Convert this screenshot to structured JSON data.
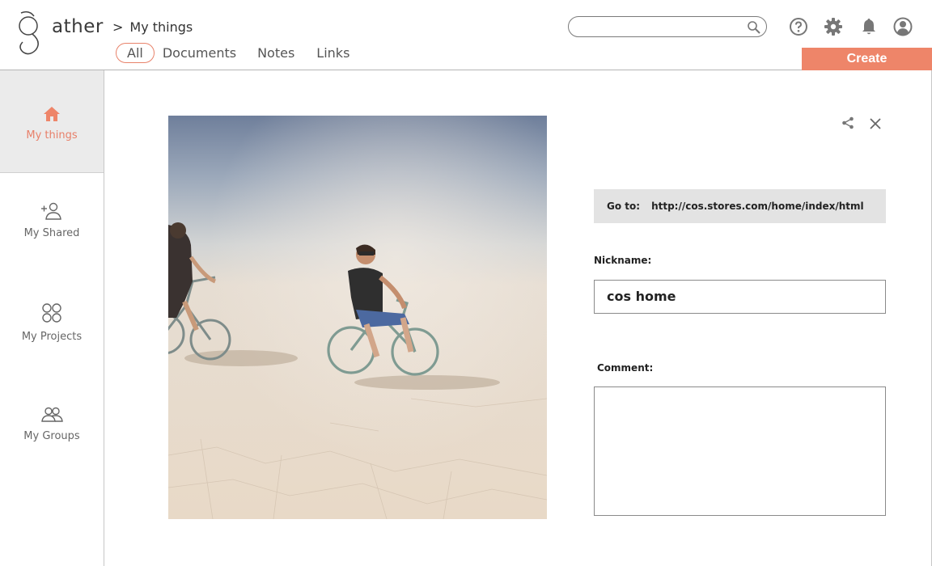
{
  "app": {
    "logo_text": "ather",
    "breadcrumb_sep": ">",
    "breadcrumb_label": "My things"
  },
  "tabs": [
    {
      "label": "All",
      "active": true
    },
    {
      "label": "Documents"
    },
    {
      "label": "Notes"
    },
    {
      "label": "Links"
    }
  ],
  "search": {
    "placeholder": "",
    "icon": "search-icon"
  },
  "top_icons": [
    "help-icon",
    "gear-icon",
    "bell-icon",
    "user-icon"
  ],
  "create_label": "Create",
  "sidebar": {
    "items": [
      {
        "label": "My things",
        "icon": "home-icon",
        "active": true
      },
      {
        "label": "My Shared",
        "icon": "add-user-icon"
      },
      {
        "label": "My Projects",
        "icon": "grid-circles-icon"
      },
      {
        "label": "My Groups",
        "icon": "group-icon"
      }
    ]
  },
  "detail": {
    "goto_label": "Go to:",
    "goto_url": "http://cos.stores.com/home/index/html",
    "nickname_label": "Nickname:",
    "nickname_value": "cos home",
    "comment_label": "Comment:",
    "comment_value": ""
  },
  "colors": {
    "accent": "#ee8569",
    "active_bg": "#ebebeb",
    "goto_bg": "#e3e3e3"
  }
}
